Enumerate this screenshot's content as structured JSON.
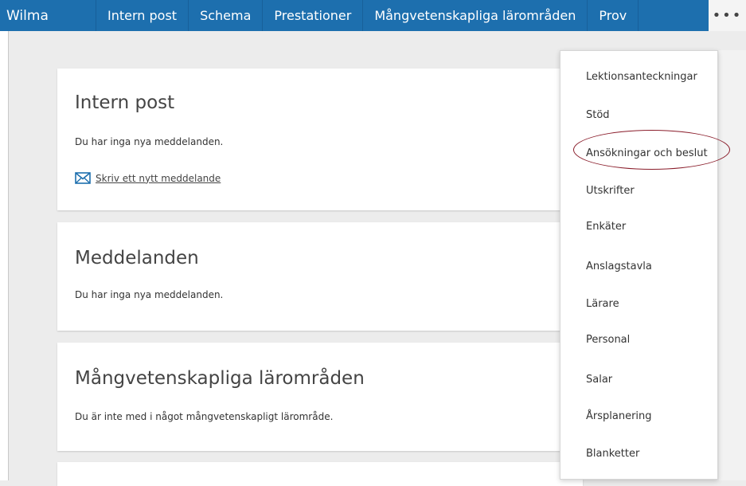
{
  "topbar": {
    "brand": "Wilma",
    "tabs": [
      "Intern post",
      "Schema",
      "Prestationer",
      "Mångvetenskapliga lärområden",
      "Prov"
    ],
    "more_label": "•••",
    "color": "#1d6fae"
  },
  "cards": {
    "internal_mail": {
      "title": "Intern post",
      "message": "Du har inga nya meddelanden.",
      "compose_label": "Skriv ett nytt meddelande"
    },
    "notices": {
      "title": "Meddelanden",
      "message": "Du har inga nya meddelanden."
    },
    "multidisciplinary": {
      "title": "Mångvetenskapliga lärområden",
      "message": "Du är inte med i något mångvetenskapligt lärområde."
    }
  },
  "dropdown": {
    "items": [
      "Lektionsanteckningar",
      "Stöd",
      "Ansökningar och beslut",
      "Utskrifter",
      "Enkäter",
      "Anslagstavla",
      "Lärare",
      "Personal",
      "Salar",
      "Årsplanering",
      "Blanketter"
    ],
    "highlighted_item": "Ansökningar och beslut",
    "highlight_color": "#8a1d2b"
  }
}
